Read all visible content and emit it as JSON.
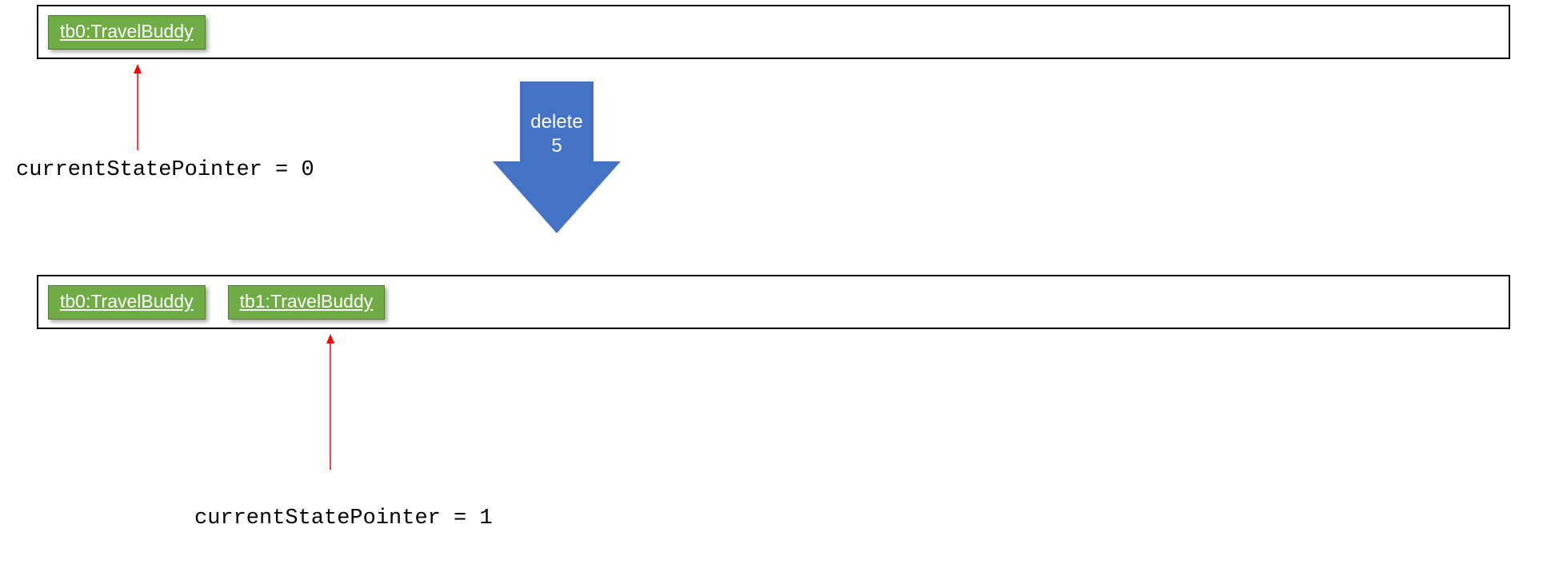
{
  "colors": {
    "boxFill": "#6fac46",
    "arrowFill": "#4472c4",
    "pointerArrow": "#ff0000"
  },
  "topContainer": {
    "states": [
      {
        "label": "tb0:TravelBuddy"
      }
    ]
  },
  "bottomContainer": {
    "states": [
      {
        "label": "tb0:TravelBuddy"
      },
      {
        "label": "tb1:TravelBuddy"
      }
    ]
  },
  "topPointer": {
    "label": "currentStatePointer = 0"
  },
  "bottomPointer": {
    "label": "currentStatePointer = 1"
  },
  "transitionArrow": {
    "line1": "delete",
    "line2": "5"
  }
}
